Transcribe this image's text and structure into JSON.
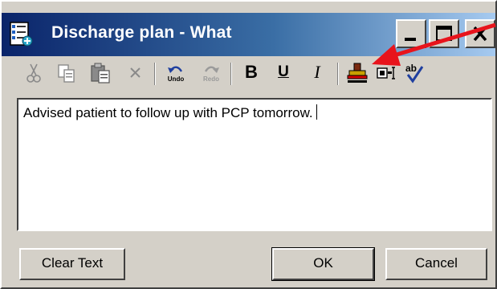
{
  "window": {
    "title": "Discharge plan - What",
    "icons": {
      "app": "document-icon",
      "minimize": "minimize-icon",
      "maximize": "maximize-icon",
      "close": "close-icon"
    }
  },
  "toolbar": {
    "buttons": [
      {
        "icon": "cut-icon"
      },
      {
        "icon": "copy-icon"
      },
      {
        "icon": "paste-icon"
      },
      {
        "icon": "delete-icon"
      },
      {
        "icon": "undo-icon",
        "label": "Undo"
      },
      {
        "icon": "redo-icon",
        "label": "Redo"
      },
      {
        "icon": "bold-icon",
        "label": "B"
      },
      {
        "icon": "underline-icon",
        "label": "U"
      },
      {
        "icon": "italic-icon",
        "label": "I"
      },
      {
        "icon": "stamp-icon"
      },
      {
        "icon": "insert-field-icon"
      },
      {
        "icon": "spell-check-icon"
      }
    ]
  },
  "editor": {
    "text": "Advised patient to follow up with PCP tomorrow."
  },
  "buttons": {
    "clear_text": "Clear Text",
    "ok": "OK",
    "cancel": "Cancel"
  },
  "annotation": {
    "color": "#e8141c"
  }
}
